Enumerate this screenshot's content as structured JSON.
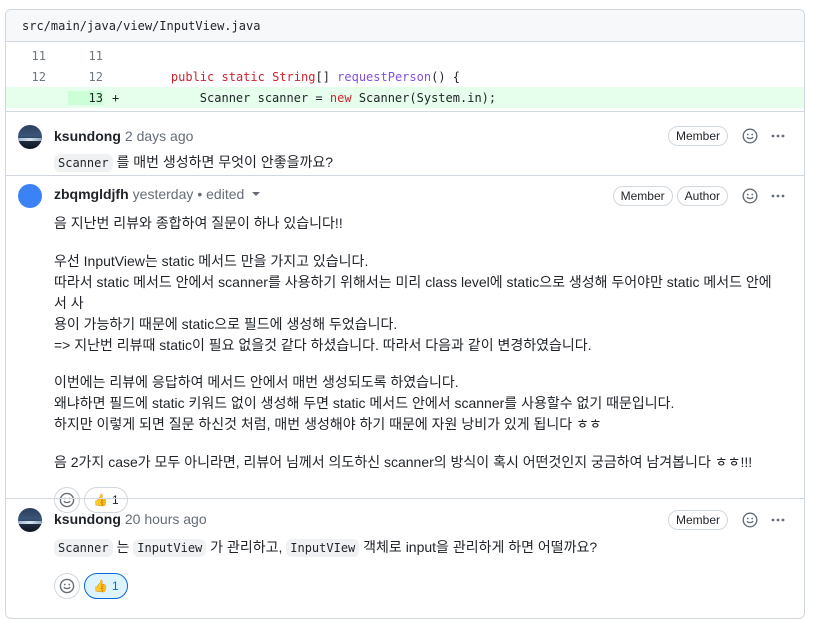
{
  "file": {
    "path": "src/main/java/view/InputView.java"
  },
  "diff": {
    "rows": [
      {
        "old": "11",
        "new": "11",
        "marker": "",
        "code": ""
      },
      {
        "old": "12",
        "new": "12",
        "marker": "",
        "code": "    public static String[] requestPerson() {"
      },
      {
        "old": "",
        "new": "13",
        "marker": "+",
        "code": "        Scanner scanner = new Scanner(System.in);"
      }
    ]
  },
  "comments": [
    {
      "author": "ksundong",
      "time": "2 days ago",
      "badges": [
        "Member"
      ],
      "body": {
        "code1": "Scanner",
        "text1": "를 매번 생성하면 무엇이 안좋을까요?"
      }
    },
    {
      "author": "zbqmgldjfh",
      "time": "yesterday",
      "edited": "• edited",
      "badges": [
        "Member",
        "Author"
      ],
      "paragraphs": [
        "음 지난번 리뷰와 종합하여 질문이 하나 있습니다!!",
        "우선 InputView는 static 메서드 만을 가지고 있습니다.",
        "따라서 static 메서드 안에서 scanner를 사용하기 위해서는 미리 class level에 static으로 생성해 두어야만 static 메서드 안에서 사",
        "용이 가능하기 때문에 static으로 필드에 생성해 두었습니다.",
        "=> 지난번 리뷰때 static이 필요 없을것 같다 하셨습니다. 따라서 다음과 같이 변경하였습니다.",
        "이번에는 리뷰에 응답하여 메서드 안에서 매번 생성되도록 하였습니다.",
        "왜냐하면 필드에 static 키워드 없이 생성해 두면 static 메서드 안에서 scanner를 사용할수 없기 때문입니다.",
        "하지만 이렇게 되면 질문 하신것 처럼, 매번 생성해야 하기 때문에 자원 낭비가 있게 됩니다 ㅎㅎ",
        "음 2가지 case가 모두 아니라면, 리뷰어 님께서 의도하신 scanner의 방식이 혹시 어떤것인지 궁금하여 남겨봅니다 ㅎㅎ!!!"
      ],
      "reaction": {
        "emoji": "👍",
        "count": "1"
      }
    },
    {
      "author": "ksundong",
      "time": "20 hours ago",
      "badges": [
        "Member"
      ],
      "body": {
        "code1": "Scanner",
        "text1": "는",
        "code2": "InputView",
        "text2": "가 관리하고,",
        "code3": "InputVIew",
        "text3": "객체로 input을 관리하게 하면 어떨까요?"
      },
      "reaction": {
        "emoji": "👍",
        "count": "1"
      }
    }
  ],
  "icons": {
    "smiley": "smiley-icon",
    "kebab": "kebab-horizontal-icon",
    "add_reaction": "add-reaction-icon"
  },
  "colors": {
    "added_bg": "#e6ffec",
    "added_num_bg": "#ccffd8",
    "keyword": "#cf222e",
    "function": "#8250df",
    "active_reaction_bg": "#ddf4ff",
    "active_reaction_border": "#0969da"
  }
}
